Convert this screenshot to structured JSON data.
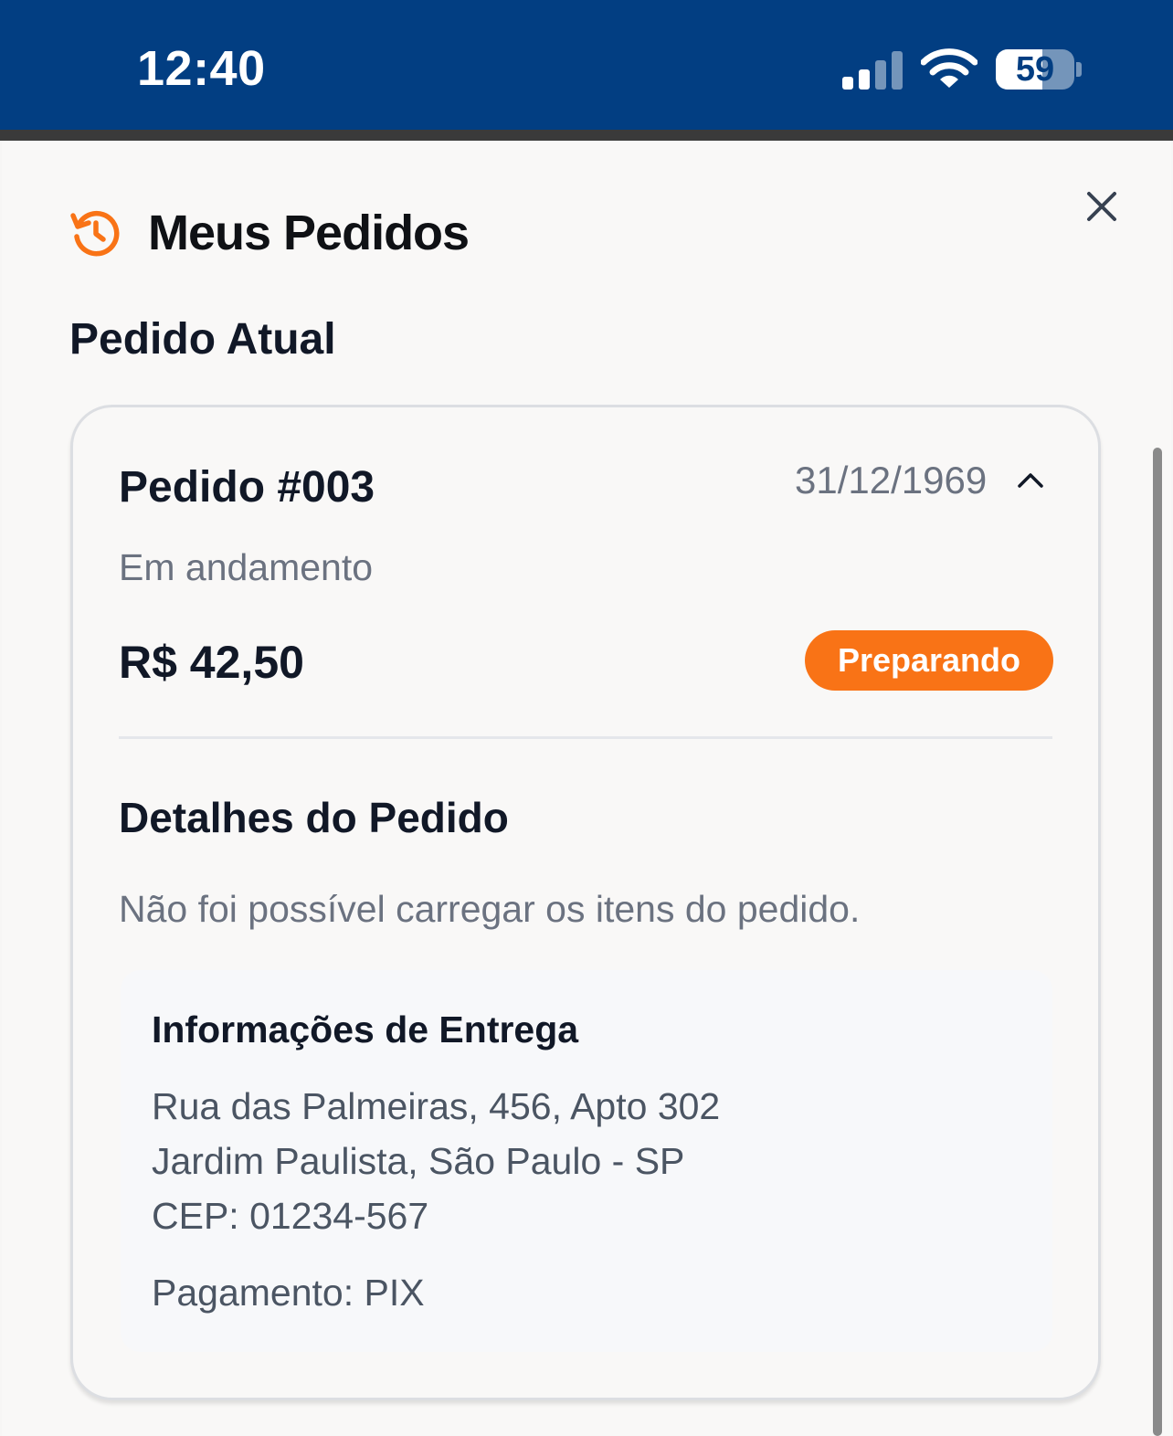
{
  "status_bar": {
    "time": "12:40",
    "battery": "59",
    "battery_level": 0.59,
    "icons": [
      "signal-icon",
      "wifi-icon",
      "battery-icon"
    ]
  },
  "header": {
    "title": "Meus Pedidos",
    "icon": "history-icon",
    "close_icon": "close-icon"
  },
  "section": {
    "title": "Pedido Atual"
  },
  "order": {
    "number": "Pedido #003",
    "date": "31/12/1969",
    "status_text": "Em andamento",
    "total": "R$ 42,50",
    "badge": "Preparando",
    "details_title": "Detalhes do Pedido",
    "items_error": "Não foi possível carregar os itens do pedido.",
    "delivery": {
      "title": "Informações de Entrega",
      "address_line1": "Rua das Palmeiras, 456, Apto 302",
      "address_line2": "Jardim Paulista, São Paulo - SP",
      "cep": "CEP: 01234-567",
      "payment": "Pagamento: PIX"
    }
  },
  "colors": {
    "status_bar": "#023e82",
    "accent": "#f97316",
    "text_primary": "#111827",
    "text_secondary": "#6b7280"
  }
}
